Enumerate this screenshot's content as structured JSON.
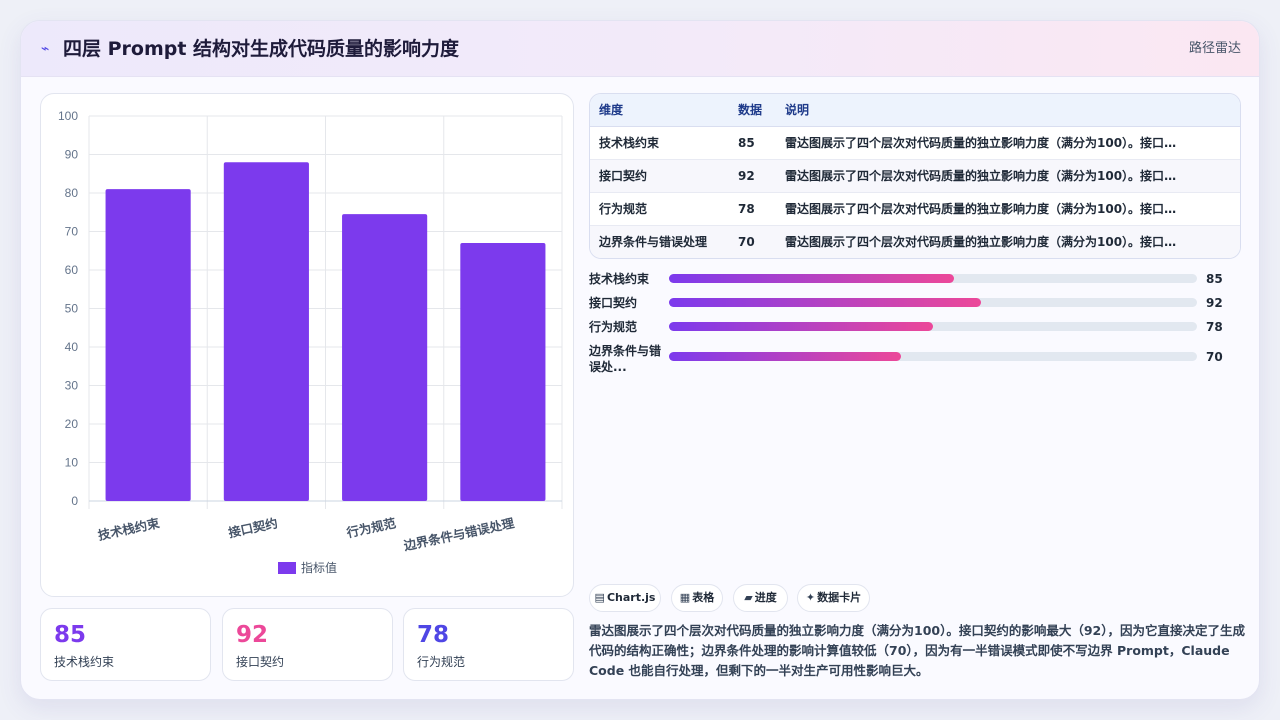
{
  "header": {
    "icon": "pulse-icon",
    "title": "四层 Prompt 结构对生成代码质量的影响力度",
    "mode_label": "路径雷达"
  },
  "chart_data": {
    "type": "bar",
    "categories": [
      "技术栈约束",
      "接口契约",
      "行为规范",
      "边界条件与错误处理"
    ],
    "series": [
      {
        "name": "指标值",
        "values": [
          81,
          88,
          74.5,
          67
        ],
        "color": "#7c3aed"
      }
    ],
    "ylim": [
      0,
      100
    ],
    "yticks": [
      0,
      10,
      20,
      30,
      40,
      50,
      60,
      70,
      80,
      90,
      100
    ],
    "grid": true,
    "legend": "bottom",
    "xlabel": "",
    "ylabel": ""
  },
  "stats": [
    {
      "value": "85",
      "label": "技术栈约束",
      "color": "#7c3aed"
    },
    {
      "value": "92",
      "label": "接口契约",
      "color": "#ec4899"
    },
    {
      "value": "78",
      "label": "行为规范",
      "color": "#4f46e5"
    }
  ],
  "table": {
    "headers": [
      "维度",
      "数据",
      "说明"
    ],
    "rows": [
      {
        "name": "技术栈约束",
        "value": "85",
        "note": "雷达图展示了四个层次对代码质量的独立影响力度（满分为100）。接口契..."
      },
      {
        "name": "接口契约",
        "value": "92",
        "note": "雷达图展示了四个层次对代码质量的独立影响力度（满分为100）。接口契..."
      },
      {
        "name": "行为规范",
        "value": "78",
        "note": "雷达图展示了四个层次对代码质量的独立影响力度（满分为100）。接口契..."
      },
      {
        "name": "边界条件与错误处理",
        "value": "70",
        "note": "雷达图展示了四个层次对代码质量的独立影响力度（满分为100）。接口契..."
      }
    ]
  },
  "progress": [
    {
      "label": "技术栈约束",
      "value": "85",
      "fraction": 0.54
    },
    {
      "label": "接口契约",
      "value": "92",
      "fraction": 0.59
    },
    {
      "label": "行为规范",
      "value": "78",
      "fraction": 0.5
    },
    {
      "label": "边界条件与错误处...",
      "value": "70",
      "fraction": 0.44
    }
  ],
  "chips": [
    {
      "icon": "chart-icon",
      "label": "Chart.js"
    },
    {
      "icon": "table-icon",
      "label": "表格"
    },
    {
      "icon": "progress-icon",
      "label": "进度"
    },
    {
      "icon": "sparkle-icon",
      "label": "数据卡片"
    }
  ],
  "description": "雷达图展示了四个层次对代码质量的独立影响力度（满分为100）。接口契约的影响最大（92），因为它直接决定了生成代码的结构正确性；边界条件处理的影响计算值较低（70），因为有一半错误模式即使不写边界 Prompt，Claude Code 也能自行处理，但剩下的一半对生产可用性影响巨大。"
}
